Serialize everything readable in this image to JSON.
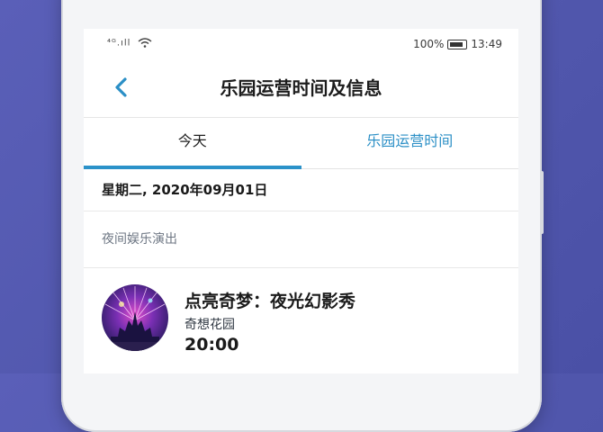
{
  "status_bar": {
    "signal": "⁴ᴳ.ıll",
    "battery_percent": "100%",
    "time": "13:49"
  },
  "header": {
    "title": "乐园运营时间及信息"
  },
  "tabs": [
    {
      "label": "今天"
    },
    {
      "label": "乐园运营时间"
    }
  ],
  "date_label": "星期二, 2020年09月01日",
  "section": {
    "label": "夜间娱乐演出"
  },
  "show": {
    "name": "点亮奇梦：夜光幻影秀",
    "location": "奇想花园",
    "time": "20:00"
  },
  "colors": {
    "accent": "#2b92c9",
    "background": "#5157ad"
  },
  "icons": {
    "back": "chevron-left-icon",
    "wifi": "wifi-icon",
    "battery": "battery-icon"
  }
}
